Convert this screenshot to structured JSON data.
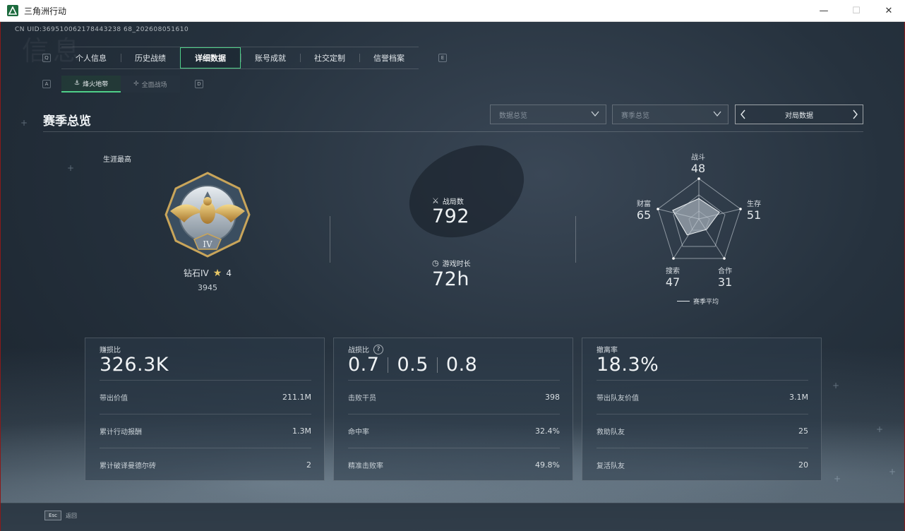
{
  "window": {
    "title": "三角洲行动",
    "minimize": "—",
    "maximize": "☐",
    "close": "✕"
  },
  "header": {
    "cn_id": "CN UID:369510062178443238 68_202608051610",
    "watermark": "信息"
  },
  "keys": {
    "prev_tab": "Q",
    "next_tab": "E",
    "prev_sub": "A",
    "next_sub": "D",
    "esc": "Esc",
    "esc_label": "返回"
  },
  "tabs": [
    {
      "label": "个人信息"
    },
    {
      "label": "历史战绩"
    },
    {
      "label": "详细数据",
      "active": true
    },
    {
      "label": "账号成就"
    },
    {
      "label": "社交定制"
    },
    {
      "label": "信誉档案"
    }
  ],
  "subtabs": [
    {
      "label": "烽火地带",
      "active": true
    },
    {
      "label": "全面战场"
    }
  ],
  "section": {
    "title": "赛季总览",
    "dropdown1": "数据总览",
    "dropdown2": "赛季总览",
    "pager_label": "对局数据"
  },
  "career": {
    "label": "生涯最高",
    "rank": "钻石IV",
    "stars": "4",
    "points": "3945",
    "badge_numeral": "IV"
  },
  "battle": {
    "matches_label": "战局数",
    "matches_value": "792",
    "playtime_label": "游戏时长",
    "playtime_value": "72h"
  },
  "radar": {
    "axes": [
      {
        "name": "战斗",
        "value": "48"
      },
      {
        "name": "生存",
        "value": "51"
      },
      {
        "name": "合作",
        "value": "31"
      },
      {
        "name": "搜索",
        "value": "47"
      },
      {
        "name": "财富",
        "value": "65"
      }
    ],
    "legend": "赛季平均"
  },
  "cards": [
    {
      "label": "赚损比",
      "big": "326.3K",
      "rows": [
        {
          "label": "带出价值",
          "value": "211.1M"
        },
        {
          "label": "累计行动报酬",
          "value": "1.3M"
        },
        {
          "label": "累计破译曼德尔砖",
          "value": "2"
        }
      ]
    },
    {
      "label": "战损比",
      "help": "?",
      "big_parts": [
        "0.7",
        "0.5",
        "0.8"
      ],
      "rows": [
        {
          "label": "击败干员",
          "value": "398"
        },
        {
          "label": "命中率",
          "value": "32.4%"
        },
        {
          "label": "精准击败率",
          "value": "49.8%"
        }
      ]
    },
    {
      "label": "撤离率",
      "big": "18.3%",
      "rows": [
        {
          "label": "带出队友价值",
          "value": "3.1M"
        },
        {
          "label": "救助队友",
          "value": "25"
        },
        {
          "label": "复活队友",
          "value": "20"
        }
      ]
    }
  ],
  "colors": {
    "accent": "#4fd089",
    "background": "#26323e"
  }
}
